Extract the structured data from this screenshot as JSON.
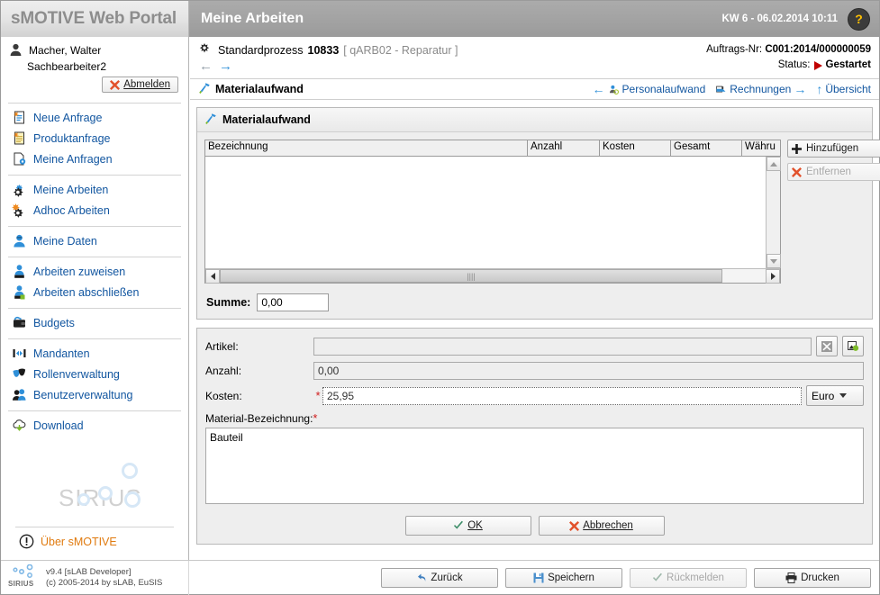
{
  "header": {
    "brand": "sMOTIVE Web Portal",
    "module_title": "Meine Arbeiten",
    "kw_datetime": "KW 6 - 06.02.2014 10:11",
    "help_glyph": "?"
  },
  "sidebar": {
    "user_name": "Macher, Walter",
    "user_role": "Sachbearbeiter2",
    "logout_label": "Abmelden",
    "groups": [
      {
        "items": [
          {
            "label": "Neue Anfrage",
            "icon": "new-request-icon",
            "name": "sidebar-item-neue-anfrage"
          },
          {
            "label": "Produktanfrage",
            "icon": "product-request-icon",
            "name": "sidebar-item-produktanfrage"
          },
          {
            "label": "Meine Anfragen",
            "icon": "my-requests-icon",
            "name": "sidebar-item-meine-anfragen"
          }
        ]
      },
      {
        "items": [
          {
            "label": "Meine Arbeiten",
            "icon": "gear-icon",
            "name": "sidebar-item-meine-arbeiten"
          },
          {
            "label": "Adhoc Arbeiten",
            "icon": "gear-star-icon",
            "name": "sidebar-item-adhoc-arbeiten"
          }
        ]
      },
      {
        "items": [
          {
            "label": "Meine Daten",
            "icon": "user-icon",
            "name": "sidebar-item-meine-daten"
          }
        ]
      },
      {
        "items": [
          {
            "label": "Arbeiten zuweisen",
            "icon": "assign-work-icon",
            "name": "sidebar-item-arbeiten-zuweisen"
          },
          {
            "label": "Arbeiten abschließen",
            "icon": "complete-work-icon",
            "name": "sidebar-item-arbeiten-abschliessen"
          }
        ]
      },
      {
        "items": [
          {
            "label": "Budgets",
            "icon": "wallet-icon",
            "name": "sidebar-item-budgets"
          }
        ]
      },
      {
        "items": [
          {
            "label": "Mandanten",
            "icon": "clients-icon",
            "name": "sidebar-item-mandanten"
          },
          {
            "label": "Rollenverwaltung",
            "icon": "roles-masks-icon",
            "name": "sidebar-item-rollenverwaltung"
          },
          {
            "label": "Benutzerverwaltung",
            "icon": "users-icon",
            "name": "sidebar-item-benutzerverwaltung"
          }
        ]
      },
      {
        "items": [
          {
            "label": "Download",
            "icon": "cloud-download-icon",
            "name": "sidebar-item-download"
          }
        ]
      }
    ],
    "logo_word": "SIRIUS",
    "about_label": "Über sMOTIVE"
  },
  "process": {
    "type_label": "Standardprozess",
    "id": "10833",
    "subtitle": "[ qARB02 - Reparatur ]",
    "order_label": "Auftrags-Nr:",
    "order_value": "C001:2014/000000059",
    "status_label": "Status:",
    "status_value": "Gestartet"
  },
  "breadcrumb": {
    "title": "Materialaufwand",
    "links": [
      {
        "label": "Personalaufwand",
        "name": "link-personalaufwand"
      },
      {
        "label": "Rechnungen",
        "name": "link-rechnungen"
      },
      {
        "label": "Übersicht",
        "name": "link-uebersicht"
      }
    ]
  },
  "panel": {
    "title": "Materialaufwand",
    "grid": {
      "columns": [
        "Bezeichnung",
        "Anzahl",
        "Kosten",
        "Gesamt",
        "Währu"
      ],
      "rows": []
    },
    "add_label": "Hinzufügen",
    "remove_label": "Entfernen",
    "summe_label": "Summe:",
    "summe_value": "0,00"
  },
  "form": {
    "artikel_label": "Artikel:",
    "artikel_value": "",
    "anzahl_label": "Anzahl:",
    "anzahl_value": "0,00",
    "kosten_label": "Kosten:",
    "kosten_value": "25,95",
    "currency_value": "Euro",
    "material_label": "Material-Bezeichnung:",
    "material_value": "Bauteil",
    "ok_label": "OK",
    "cancel_label": "Abbrechen"
  },
  "footer": {
    "version": "v9.4 [sLAB Developer]",
    "copyright": "(c) 2005-2014 by sLAB, EuSIS",
    "logo_word": "SIRIUS",
    "buttons": [
      {
        "label": "Zurück",
        "name": "back-button",
        "disabled": false
      },
      {
        "label": "Speichern",
        "name": "save-button",
        "disabled": false
      },
      {
        "label": "Rückmelden",
        "name": "report-button",
        "disabled": true
      },
      {
        "label": "Drucken",
        "name": "print-button",
        "disabled": false
      }
    ]
  },
  "colors": {
    "link": "#1256a0",
    "accent_orange": "#e07b10",
    "status_red": "#c00000",
    "header_grey": "#a3a3a3"
  }
}
